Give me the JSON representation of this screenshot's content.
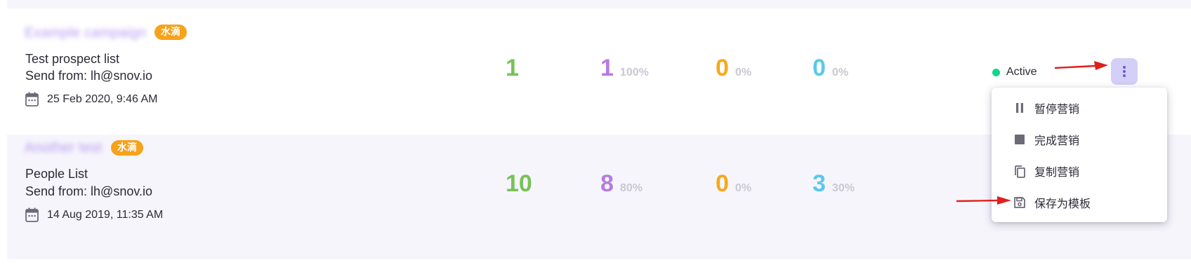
{
  "colors": {
    "sent": "#78c257",
    "opened": "#b67be0",
    "clicked": "#f5a91b",
    "replied": "#5bc8ee",
    "badge": "#f7a21b",
    "active_dot": "#12d68d",
    "more_button_bg": "#d3cff7",
    "row_alt_bg": "#f6f5fc",
    "arrow": "#e0201c"
  },
  "campaigns": [
    {
      "name": "Example campaign",
      "badge": "水滴",
      "list_name": "Test prospect list",
      "send_from": "Send from: lh@snov.io",
      "date": "25 Feb 2020, 9:46 AM",
      "stats": {
        "sent": "1",
        "opened": "1",
        "opened_pct": "100%",
        "clicked": "0",
        "clicked_pct": "0%",
        "replied": "0",
        "replied_pct": "0%"
      },
      "status": "Active"
    },
    {
      "name": "Another test",
      "badge": "水滴",
      "list_name": "People List",
      "send_from": "Send from: lh@snov.io",
      "date": "14 Aug 2019, 11:35 AM",
      "stats": {
        "sent": "10",
        "opened": "8",
        "opened_pct": "80%",
        "clicked": "0",
        "clicked_pct": "0%",
        "replied": "3",
        "replied_pct": "30%"
      }
    }
  ],
  "menu": {
    "items": [
      {
        "label": "暂停营销",
        "icon": "pause-icon"
      },
      {
        "label": "完成营销",
        "icon": "stop-icon"
      },
      {
        "label": "复制营销",
        "icon": "copy-icon"
      },
      {
        "label": "保存为模板",
        "icon": "save-icon"
      }
    ]
  },
  "icons": {
    "date": "calendar-icon",
    "more": "more-vertical-icon",
    "annotation": "red-arrow-icon"
  }
}
